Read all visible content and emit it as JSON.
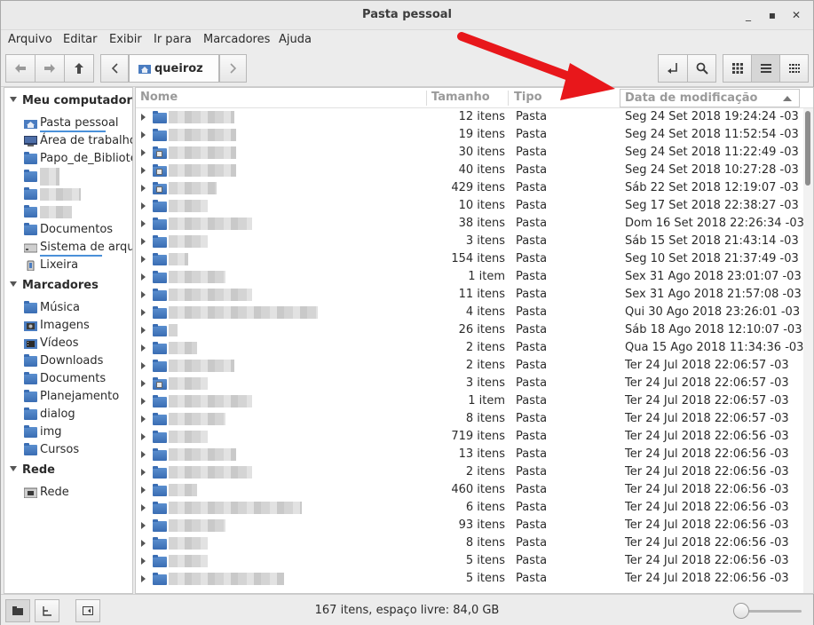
{
  "window": {
    "title": "Pasta pessoal"
  },
  "menu": [
    "Arquivo",
    "Editar",
    "Exibir",
    "Ir para",
    "Marcadores",
    "Ajuda"
  ],
  "location": {
    "current": "queiroz"
  },
  "sidebar": {
    "computer_header": "Meu computador",
    "computer_items": [
      "Pasta pessoal",
      "Área de trabalho",
      "Papo_de_Biblioteca",
      "",
      "",
      "",
      "Documentos",
      "Sistema de arquivos",
      "Lixeira"
    ],
    "bookmarks_header": "Marcadores",
    "bookmarks": [
      "Música",
      "Imagens",
      "Vídeos",
      "Downloads",
      "Documents",
      "Planejamento",
      "dialog",
      "img",
      "Cursos"
    ],
    "network_header": "Rede",
    "network_items": [
      "Rede"
    ]
  },
  "columns": {
    "name": "Nome",
    "size": "Tamanho",
    "type": "Tipo",
    "date": "Data de modificação"
  },
  "files": [
    {
      "size": "12 itens",
      "type": "Pasta",
      "date": "Seg 24 Set 2018 19:24:24 -03"
    },
    {
      "size": "19 itens",
      "type": "Pasta",
      "date": "Seg 24 Set 2018 11:52:54 -03"
    },
    {
      "size": "30 itens",
      "type": "Pasta",
      "date": "Seg 24 Set 2018 11:22:49 -03"
    },
    {
      "size": "40 itens",
      "type": "Pasta",
      "date": "Seg 24 Set 2018 10:27:28 -03"
    },
    {
      "size": "429 itens",
      "type": "Pasta",
      "date": "Sáb 22 Set 2018 12:19:07 -03"
    },
    {
      "size": "10 itens",
      "type": "Pasta",
      "date": "Seg 17 Set 2018 22:38:27 -03"
    },
    {
      "size": "38 itens",
      "type": "Pasta",
      "date": "Dom 16 Set 2018 22:26:34 -03"
    },
    {
      "size": "3 itens",
      "type": "Pasta",
      "date": "Sáb 15 Set 2018 21:43:14 -03"
    },
    {
      "size": "154 itens",
      "type": "Pasta",
      "date": "Seg 10 Set 2018 21:37:49 -03"
    },
    {
      "size": "1 item",
      "type": "Pasta",
      "date": "Sex 31 Ago 2018 23:01:07 -03"
    },
    {
      "size": "11 itens",
      "type": "Pasta",
      "date": "Sex 31 Ago 2018 21:57:08 -03"
    },
    {
      "size": "4 itens",
      "type": "Pasta",
      "date": "Qui 30 Ago 2018 23:26:01 -03"
    },
    {
      "size": "26 itens",
      "type": "Pasta",
      "date": "Sáb 18 Ago 2018 12:10:07 -03"
    },
    {
      "size": "2 itens",
      "type": "Pasta",
      "date": "Qua 15 Ago 2018 11:34:36 -03"
    },
    {
      "size": "2 itens",
      "type": "Pasta",
      "date": "Ter 24 Jul 2018 22:06:57 -03"
    },
    {
      "size": "3 itens",
      "type": "Pasta",
      "date": "Ter 24 Jul 2018 22:06:57 -03"
    },
    {
      "size": "1 item",
      "type": "Pasta",
      "date": "Ter 24 Jul 2018 22:06:57 -03"
    },
    {
      "size": "8 itens",
      "type": "Pasta",
      "date": "Ter 24 Jul 2018 22:06:57 -03"
    },
    {
      "size": "719 itens",
      "type": "Pasta",
      "date": "Ter 24 Jul 2018 22:06:56 -03"
    },
    {
      "size": "13 itens",
      "type": "Pasta",
      "date": "Ter 24 Jul 2018 22:06:56 -03"
    },
    {
      "size": "2 itens",
      "type": "Pasta",
      "date": "Ter 24 Jul 2018 22:06:56 -03"
    },
    {
      "size": "460 itens",
      "type": "Pasta",
      "date": "Ter 24 Jul 2018 22:06:56 -03"
    },
    {
      "size": "6 itens",
      "type": "Pasta",
      "date": "Ter 24 Jul 2018 22:06:56 -03"
    },
    {
      "size": "93 itens",
      "type": "Pasta",
      "date": "Ter 24 Jul 2018 22:06:56 -03"
    },
    {
      "size": "8 itens",
      "type": "Pasta",
      "date": "Ter 24 Jul 2018 22:06:56 -03"
    },
    {
      "size": "5 itens",
      "type": "Pasta",
      "date": "Ter 24 Jul 2018 22:06:56 -03"
    },
    {
      "size": "5 itens",
      "type": "Pasta",
      "date": "Ter 24 Jul 2018 22:06:56 -03"
    }
  ],
  "status": {
    "text": "167 itens, espaço livre: 84,0 GB"
  },
  "colors": {
    "folder": "#4a7cc0",
    "annotation_arrow": "#e8171b",
    "accent": "#4a90d9"
  },
  "icons": {
    "back": "arrow-left-icon",
    "forward": "arrow-right-icon",
    "up": "arrow-up-icon",
    "prev_crumb": "chevron-left-icon",
    "next_crumb": "chevron-right-icon",
    "toggle_location": "location-toggle-icon",
    "search": "search-icon",
    "view_icons": "grid-view-icon",
    "view_list": "list-view-icon",
    "view_compact": "compact-view-icon"
  }
}
